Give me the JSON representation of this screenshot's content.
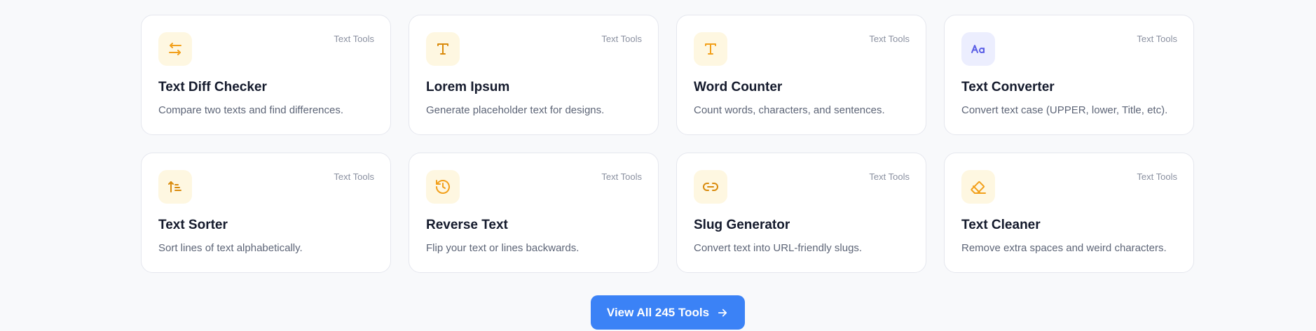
{
  "tools": [
    {
      "title": "Text Diff Checker",
      "description": "Compare two texts and find differences.",
      "category": "Text Tools",
      "icon": "arrows-swap-icon",
      "icon_color": "#f2a01b",
      "icon_bg": "#fef7e1"
    },
    {
      "title": "Lorem Ipsum",
      "description": "Generate placeholder text for designs.",
      "category": "Text Tools",
      "icon": "text-type-icon",
      "icon_color": "#d98a0b",
      "icon_bg": "#fef7e1"
    },
    {
      "title": "Word Counter",
      "description": "Count words, characters, and sentences.",
      "category": "Text Tools",
      "icon": "text-type-icon",
      "icon_color": "#f2a01b",
      "icon_bg": "#fef7e1"
    },
    {
      "title": "Text Converter",
      "description": "Convert text case (UPPER, lower, Title, etc).",
      "category": "Text Tools",
      "icon": "letter-case-icon",
      "icon_color": "#5b5fe6",
      "icon_bg": "#eceefe"
    },
    {
      "title": "Text Sorter",
      "description": "Sort lines of text alphabetically.",
      "category": "Text Tools",
      "icon": "sort-ascending-icon",
      "icon_color": "#d98a0b",
      "icon_bg": "#fef7e1"
    },
    {
      "title": "Reverse Text",
      "description": "Flip your text or lines backwards.",
      "category": "Text Tools",
      "icon": "history-icon",
      "icon_color": "#f2a01b",
      "icon_bg": "#fef7e1"
    },
    {
      "title": "Slug Generator",
      "description": "Convert text into URL-friendly slugs.",
      "category": "Text Tools",
      "icon": "link-icon",
      "icon_color": "#d98a0b",
      "icon_bg": "#fef7e1"
    },
    {
      "title": "Text Cleaner",
      "description": "Remove extra spaces and weird characters.",
      "category": "Text Tools",
      "icon": "eraser-icon",
      "icon_color": "#f2a01b",
      "icon_bg": "#fef7e1"
    }
  ],
  "view_all": {
    "label": "View All 245 Tools",
    "icon": "arrow-right-icon",
    "color": "#3b82f6"
  }
}
